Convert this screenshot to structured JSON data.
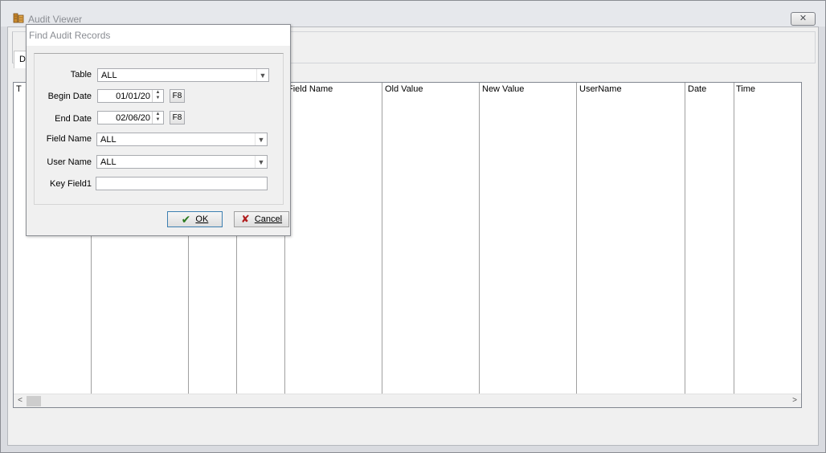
{
  "window": {
    "title": "Audit Viewer",
    "close_glyph": "✕"
  },
  "tabs": [
    {
      "label": "D"
    }
  ],
  "grid": {
    "columns": [
      {
        "label": "T"
      },
      {
        "label": ""
      },
      {
        "label": ""
      },
      {
        "label": ""
      },
      {
        "label": "Field Name"
      },
      {
        "label": "Old Value"
      },
      {
        "label": "New Value"
      },
      {
        "label": "UserName"
      },
      {
        "label": "Date"
      },
      {
        "label": "Time"
      }
    ],
    "scroll_left_glyph": "<",
    "scroll_right_glyph": ">"
  },
  "dialog": {
    "title": "Find Audit Records",
    "table": {
      "label": "Table",
      "value": "ALL"
    },
    "begin_date": {
      "label": "Begin Date",
      "value": "01/01/20",
      "shortcut": "F8"
    },
    "end_date": {
      "label": "End Date",
      "value": "02/06/20",
      "shortcut": "F8"
    },
    "field_name": {
      "label": "Field Name",
      "value": "ALL"
    },
    "user_name": {
      "label": "User Name",
      "value": "ALL"
    },
    "key_field1": {
      "label": "Key Field1",
      "value": ""
    },
    "ok_label": "OK",
    "cancel_label": "Cancel",
    "ok_icon_glyph": "✔",
    "cancel_icon_glyph": "✘"
  },
  "colors": {
    "ok_icon": "#2b7a1f",
    "cancel_icon": "#b01c1c",
    "ok_border": "#3c7fb1"
  }
}
